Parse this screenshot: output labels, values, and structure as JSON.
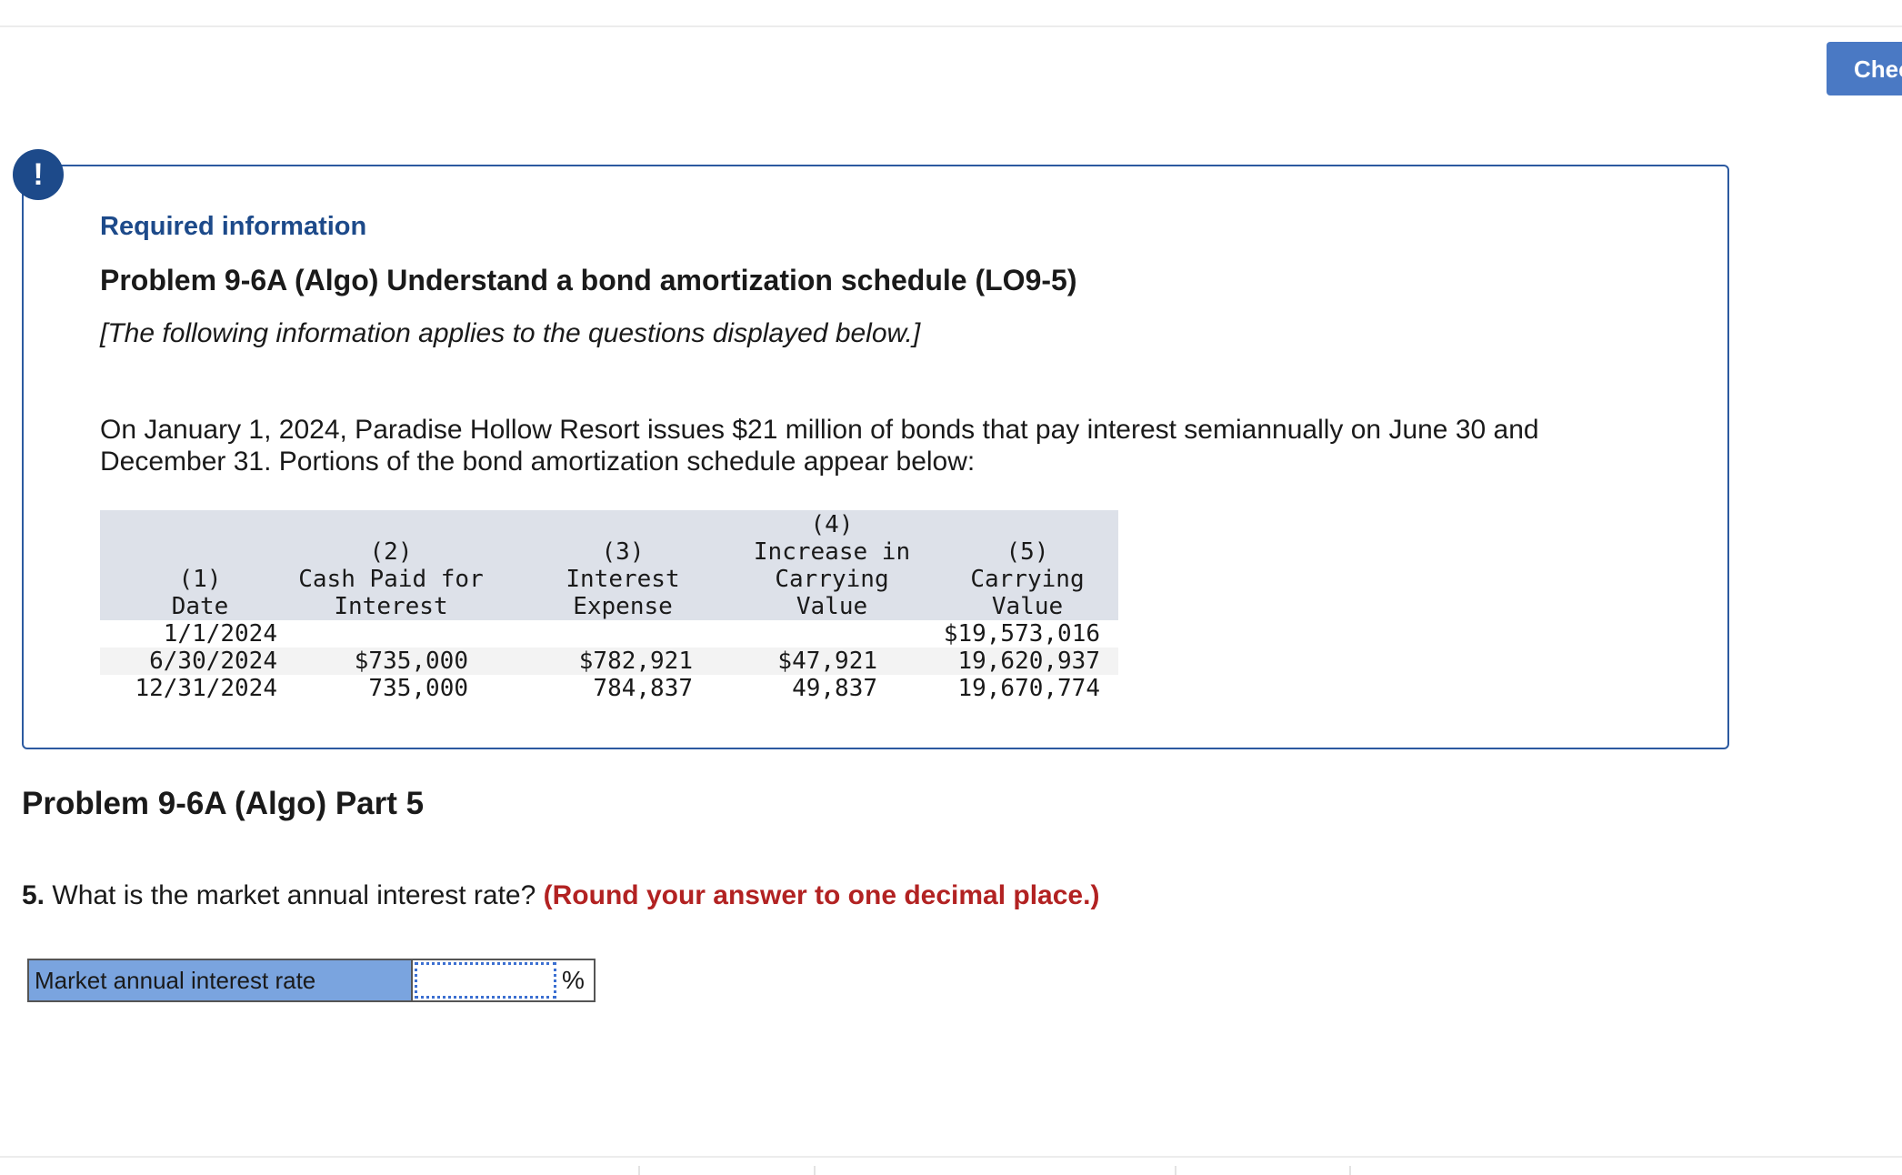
{
  "toolbar": {
    "check_label": "Check my work"
  },
  "info": {
    "alert_glyph": "!",
    "required_label": "Required information",
    "problem_title": "Problem 9-6A (Algo) Understand a bond amortization schedule (LO9-5)",
    "applies_note": "[The following information applies to the questions displayed below.]",
    "scenario": "On January 1, 2024, Paradise Hollow Resort issues $21 million of bonds that pay interest semiannually on June 30 and December 31. Portions of the bond amortization schedule appear below:"
  },
  "schedule": {
    "headers": [
      "(1)\nDate",
      "(2)\nCash Paid for\nInterest",
      "(3)\nInterest\nExpense",
      "(4)\nIncrease in\nCarrying\nValue",
      "(5)\nCarrying\nValue"
    ],
    "rows": [
      [
        "1/1/2024",
        "",
        "",
        "",
        "$19,573,016"
      ],
      [
        "6/30/2024",
        "$735,000",
        "$782,921",
        "$47,921",
        "19,620,937"
      ],
      [
        "12/31/2024",
        "735,000",
        "784,837",
        "49,837",
        "19,670,774"
      ]
    ]
  },
  "part": {
    "title": "Problem 9-6A (Algo) Part 5",
    "question_number": "5.",
    "question_text": "What is the market annual interest rate?",
    "question_hint": "(Round your answer to one decimal place.)",
    "answer_label": "Market annual interest rate",
    "answer_value": "",
    "answer_unit": "%"
  },
  "colors": {
    "brand_blue": "#1d4a8a",
    "button_blue": "#4a79c4",
    "hint_red": "#b22222",
    "label_fill": "#7aa4df",
    "table_header": "#dde1e9"
  }
}
